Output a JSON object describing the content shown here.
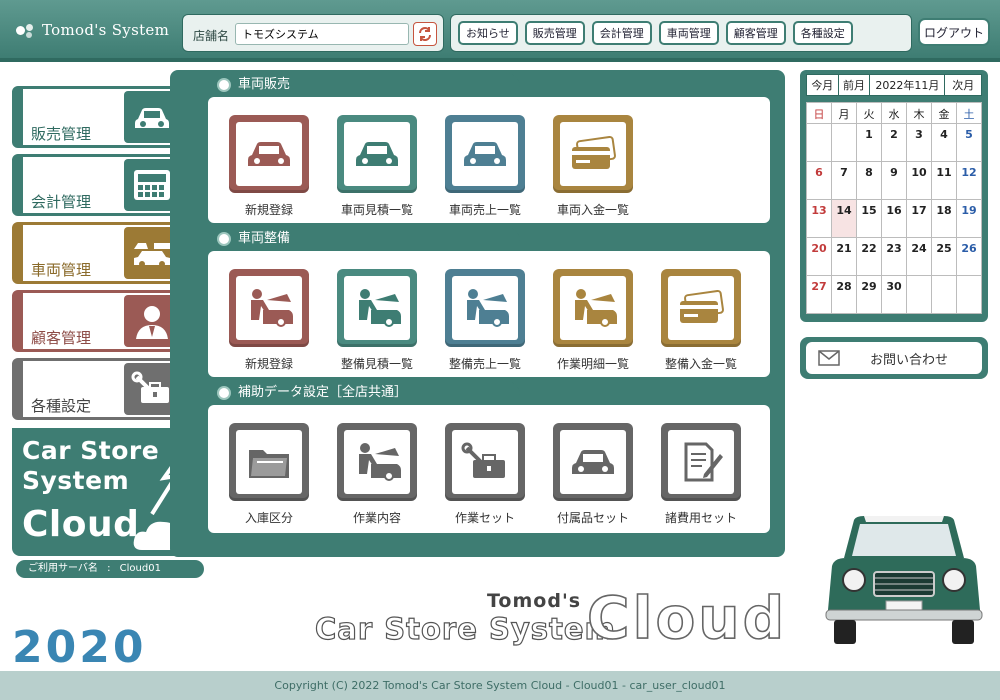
{
  "header": {
    "logo_text": "Tomod's System",
    "store_label": "店舗名",
    "store_value": "トモズシステム",
    "nav": [
      "お知らせ",
      "販売管理",
      "会計管理",
      "車両管理",
      "顧客管理",
      "各種設定"
    ],
    "logout": "ログアウト"
  },
  "left_menu": {
    "sales": "販売管理",
    "accounting": "会計管理",
    "vehicle": "車両管理",
    "customer": "顧客管理",
    "settings": "各種設定"
  },
  "brand": {
    "line1": "Car Store",
    "line2": "System",
    "line3": "Cloud"
  },
  "server": {
    "label": "ご利用サーバ名",
    "sep": ":",
    "value": "Cloud01"
  },
  "year": "2020",
  "sections": {
    "sales": {
      "title": "車両販売",
      "items": [
        "新規登録",
        "車両見積一覧",
        "車両売上一覧",
        "車両入金一覧"
      ]
    },
    "maintenance": {
      "title": "車両整備",
      "items": [
        "新規登録",
        "整備見積一覧",
        "整備売上一覧",
        "作業明細一覧",
        "整備入金一覧"
      ]
    },
    "aux": {
      "title": "補助データ設定［全店共通］",
      "items": [
        "入庫区分",
        "作業内容",
        "作業セット",
        "付属品セット",
        "諸費用セット"
      ]
    }
  },
  "calendar": {
    "nav": {
      "this_month": "今月",
      "prev_month": "前月",
      "current": "2022年11月",
      "next_month": "次月"
    },
    "weekdays": [
      "日",
      "月",
      "火",
      "水",
      "木",
      "金",
      "土"
    ],
    "weeks": [
      [
        "",
        "",
        "1",
        "2",
        "3",
        "4",
        "5"
      ],
      [
        "6",
        "7",
        "8",
        "9",
        "10",
        "11",
        "12"
      ],
      [
        "13",
        "14",
        "15",
        "16",
        "17",
        "18",
        "19"
      ],
      [
        "20",
        "21",
        "22",
        "23",
        "24",
        "25",
        "26"
      ],
      [
        "27",
        "28",
        "29",
        "30",
        "",
        "",
        ""
      ]
    ],
    "today": "14"
  },
  "contact": "お問い合わせ",
  "big_logo": {
    "small": "Tomod's",
    "mid": "Car Store System",
    "big": "Cloud"
  },
  "footer": "Copyright (C) 2022 Tomod's Car Store System Cloud - Cloud01 - car_user_cloud01",
  "colors": {
    "primary": "#3e7d73",
    "gold": "#9c7a35",
    "red": "#9b5a55",
    "gray": "#6f6f6f",
    "blue": "#4e7f93"
  }
}
